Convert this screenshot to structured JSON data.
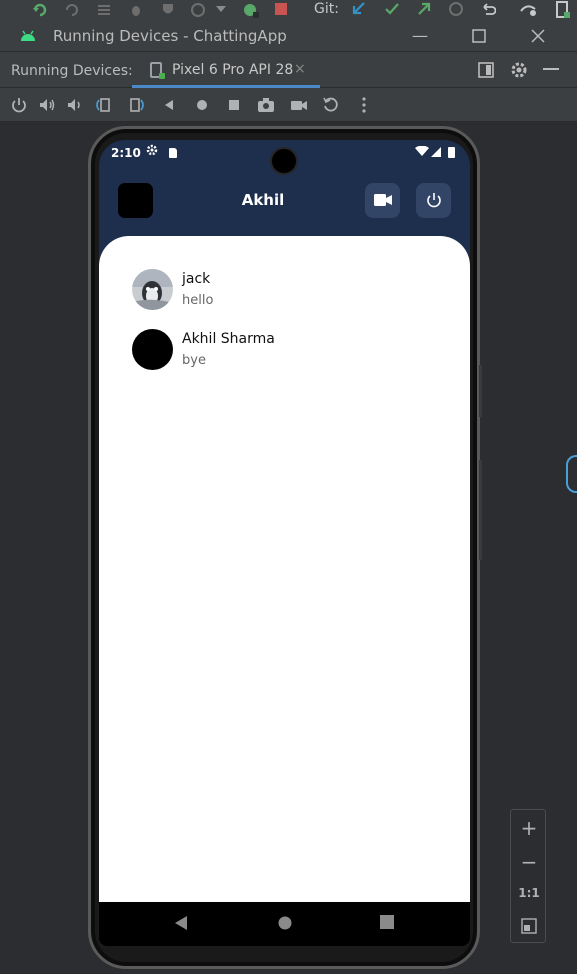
{
  "ide": {
    "git_label": "Git:",
    "window_title": "Running Devices - ChattingApp",
    "running_devices_label": "Running Devices:",
    "device_tab_label": "Pixel 6 Pro API 28",
    "tab_close": "×"
  },
  "colors": {
    "ide_bg": "#2b2d30",
    "panel_bg": "#3c3f41",
    "accent_blue": "#4a88c7",
    "app_primary": "#1e2f4d",
    "app_button": "#324566",
    "fab_icon": "#3b2fb5"
  },
  "device_controls": [
    "power-icon",
    "volume-up-icon",
    "volume-down-icon",
    "rotate-left-icon",
    "rotate-right-icon",
    "back-icon",
    "home-icon",
    "overview-icon",
    "camera-icon",
    "video-record-icon",
    "restore-icon",
    "more-icon"
  ],
  "phone": {
    "status": {
      "time": "2:10"
    },
    "appbar": {
      "title": "Akhil"
    },
    "chats": [
      {
        "name": "jack",
        "message": "hello",
        "avatar": "photo"
      },
      {
        "name": "Akhil Sharma",
        "message": "bye",
        "avatar": "black"
      }
    ],
    "fab_label": "+"
  },
  "zoom": {
    "zoom_in": "+",
    "zoom_out": "−",
    "actual_size": "1:1"
  }
}
